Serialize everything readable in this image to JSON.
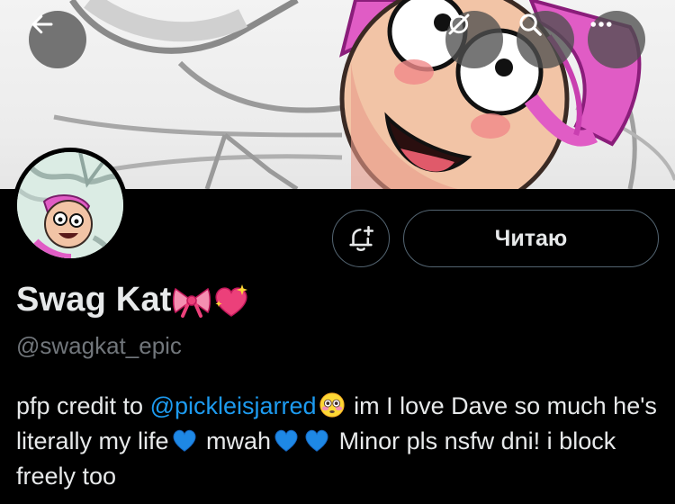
{
  "header": {
    "back_icon": "arrow-left-icon",
    "grok_icon": "grok-icon",
    "search_icon": "search-icon",
    "more_icon": "more-dots-icon"
  },
  "profile": {
    "display_name": "Swag Kat",
    "name_emojis": [
      "ribbon",
      "sparkling-heart"
    ],
    "handle": "@swagkat_epic",
    "follow_label": "Читаю",
    "notify_icon": "bell-plus-icon"
  },
  "bio": {
    "prefix": "pfp credit to",
    "mention": "@pickleisjarred",
    "after_flushed": "im I love Dave so much he's literally my life",
    "mwah": "mwah",
    "tail": "Minor pls nsfw dni! i block freely too"
  },
  "colors": {
    "background": "#000000",
    "text": "#e7e9ea",
    "secondary_text": "#71767b",
    "link": "#1d9bf0",
    "button_border": "#536471"
  }
}
